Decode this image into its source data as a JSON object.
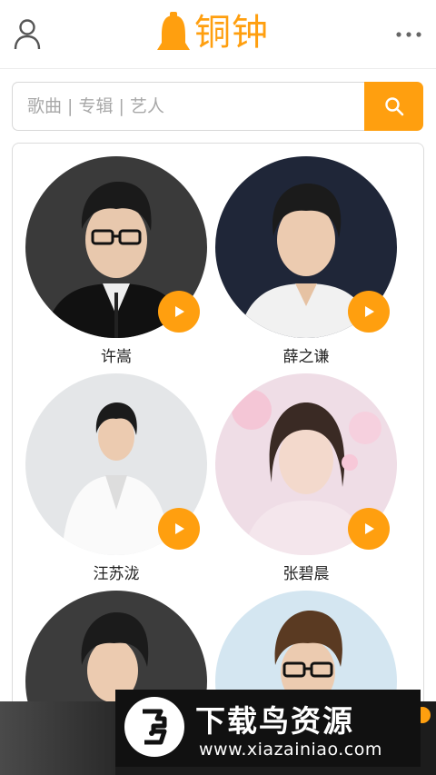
{
  "header": {
    "logo_text": "铜钟",
    "user_icon": "user-icon",
    "more_icon": "more-dots-icon"
  },
  "search": {
    "placeholder": "歌曲 | 专辑 | 艺人",
    "button_icon": "search-icon"
  },
  "artists": [
    {
      "name": "许嵩"
    },
    {
      "name": "薛之谦"
    },
    {
      "name": "汪苏泷"
    },
    {
      "name": "张碧晨"
    },
    {
      "name": ""
    },
    {
      "name": ""
    }
  ],
  "watermark": {
    "title": "下载鸟资源",
    "url": "www.xiazainiao.com"
  },
  "colors": {
    "accent": "#ff9f0f",
    "text": "#222222",
    "border": "#dcdcdc"
  }
}
